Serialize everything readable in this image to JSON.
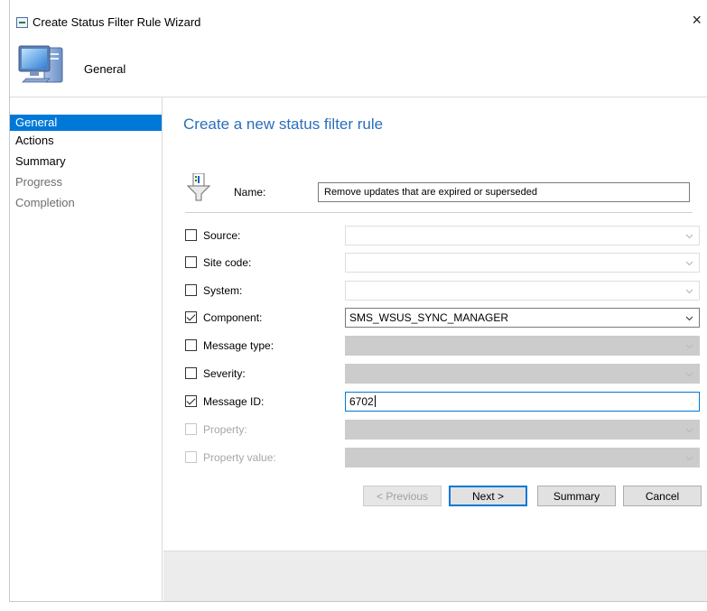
{
  "window": {
    "title": "Create Status Filter Rule Wizard",
    "close_glyph": "×",
    "header_title": "General",
    "header_icon": "computer-icon"
  },
  "nav": {
    "items": [
      {
        "label": "General",
        "state": "selected"
      },
      {
        "label": "Actions",
        "state": "normal"
      },
      {
        "label": "Summary",
        "state": "normal"
      },
      {
        "label": "Progress",
        "state": "disabled"
      },
      {
        "label": "Completion",
        "state": "disabled"
      }
    ]
  },
  "page": {
    "heading": "Create a new status filter rule",
    "name_label": "Name:",
    "name_value": "Remove updates that are expired or superseded",
    "name_icon": "filter-icon"
  },
  "criteria": [
    {
      "label": "Source:",
      "checked": false,
      "enabled": true,
      "value": "",
      "control": "dropdown-light"
    },
    {
      "label": "Site code:",
      "checked": false,
      "enabled": true,
      "value": "",
      "control": "dropdown-light"
    },
    {
      "label": "System:",
      "checked": false,
      "enabled": true,
      "value": "",
      "control": "dropdown-light"
    },
    {
      "label": "Component:",
      "checked": true,
      "enabled": true,
      "value": "SMS_WSUS_SYNC_MANAGER",
      "control": "dropdown-active"
    },
    {
      "label": "Message type:",
      "checked": false,
      "enabled": true,
      "value": "",
      "control": "dropdown-gray"
    },
    {
      "label": "Severity:",
      "checked": false,
      "enabled": true,
      "value": "",
      "control": "dropdown-gray"
    },
    {
      "label": "Message ID:",
      "checked": true,
      "enabled": true,
      "value": "6702",
      "control": "text-focused"
    },
    {
      "label": "Property:",
      "checked": false,
      "enabled": false,
      "value": "",
      "control": "dropdown-gray"
    },
    {
      "label": "Property value:",
      "checked": false,
      "enabled": false,
      "value": "",
      "control": "dropdown-gray"
    }
  ],
  "buttons": {
    "previous": "< Previous",
    "next": "Next >",
    "summary": "Summary",
    "cancel": "Cancel"
  },
  "colors": {
    "accent": "#0078d7",
    "heading": "#2a6ebb"
  }
}
